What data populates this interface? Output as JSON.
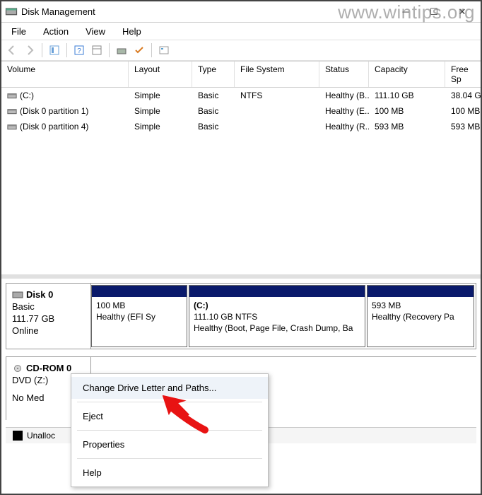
{
  "window": {
    "title": "Disk Management"
  },
  "menu": {
    "file": "File",
    "action": "Action",
    "view": "View",
    "help": "Help"
  },
  "columns": {
    "volume": "Volume",
    "layout": "Layout",
    "type": "Type",
    "filesystem": "File System",
    "status": "Status",
    "capacity": "Capacity",
    "freespace": "Free Sp"
  },
  "volumes": [
    {
      "name": "(C:)",
      "layout": "Simple",
      "type": "Basic",
      "fs": "NTFS",
      "status": "Healthy (B...",
      "cap": "111.10 GB",
      "free": "38.04 G"
    },
    {
      "name": "(Disk 0 partition 1)",
      "layout": "Simple",
      "type": "Basic",
      "fs": "",
      "status": "Healthy (E...",
      "cap": "100 MB",
      "free": "100 MB"
    },
    {
      "name": "(Disk 0 partition 4)",
      "layout": "Simple",
      "type": "Basic",
      "fs": "",
      "status": "Healthy (R...",
      "cap": "593 MB",
      "free": "593 MB"
    }
  ],
  "disk0": {
    "name": "Disk 0",
    "type": "Basic",
    "size": "111.77 GB",
    "state": "Online",
    "parts": [
      {
        "title": "",
        "line1": "100 MB",
        "line2": "Healthy (EFI Sy"
      },
      {
        "title": "(C:)",
        "line1": "111.10 GB NTFS",
        "line2": "Healthy (Boot, Page File, Crash Dump, Ba"
      },
      {
        "title": "",
        "line1": "593 MB",
        "line2": "Healthy (Recovery Pa"
      }
    ]
  },
  "cdrom": {
    "name": "CD-ROM 0",
    "drive": "DVD (Z:)",
    "state": "No Med"
  },
  "legend": {
    "unalloc": "Unalloc"
  },
  "context": {
    "change": "Change Drive Letter and Paths...",
    "eject": "Eject",
    "properties": "Properties",
    "help": "Help"
  },
  "watermark": "www.wintips.org"
}
